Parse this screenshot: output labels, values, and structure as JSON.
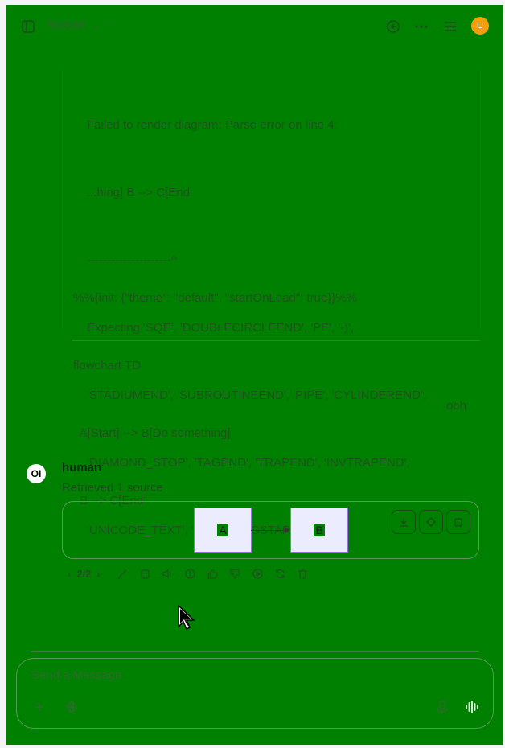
{
  "header": {
    "model_name": "human",
    "avatar_initial": "U"
  },
  "error_block": {
    "lines": [
      "Failed to render diagram: Parse error on line 4:",
      "...hing] B --> C[End",
      "---------------------^",
      "Expecting 'SQE', 'DOUBLECIRCLEEND', 'PE', '-)',",
      "'STADIUMEND', 'SUBROUTINEEND', 'PIPE', 'CYLINDEREND',",
      "'DIAMOND_STOP', 'TAGEND', 'TRAPEND', 'INVTRAPEND',",
      "'UNICODE_TEXT', 'TEXT', 'TAGSTART', got '1'"
    ],
    "code": [
      "%%{init: {\"theme\": \"default\", \"startOnLoad\": true}}%%",
      "flowchart TD",
      "  A[Start] --> B[Do something]",
      "  B --> C[End"
    ]
  },
  "user_message": "ooh",
  "assistant": {
    "avatar_text": "OI",
    "name": "human",
    "sources_text": "Retrieved 1 source",
    "diagram": {
      "node_a": "A",
      "node_b": "B"
    },
    "pager": "2/2"
  },
  "input": {
    "placeholder": "Send a Message"
  },
  "colors": {
    "background": "#008000",
    "avatar": "#f59e0b",
    "node_fill": "#ececff",
    "node_border": "#9370db"
  }
}
